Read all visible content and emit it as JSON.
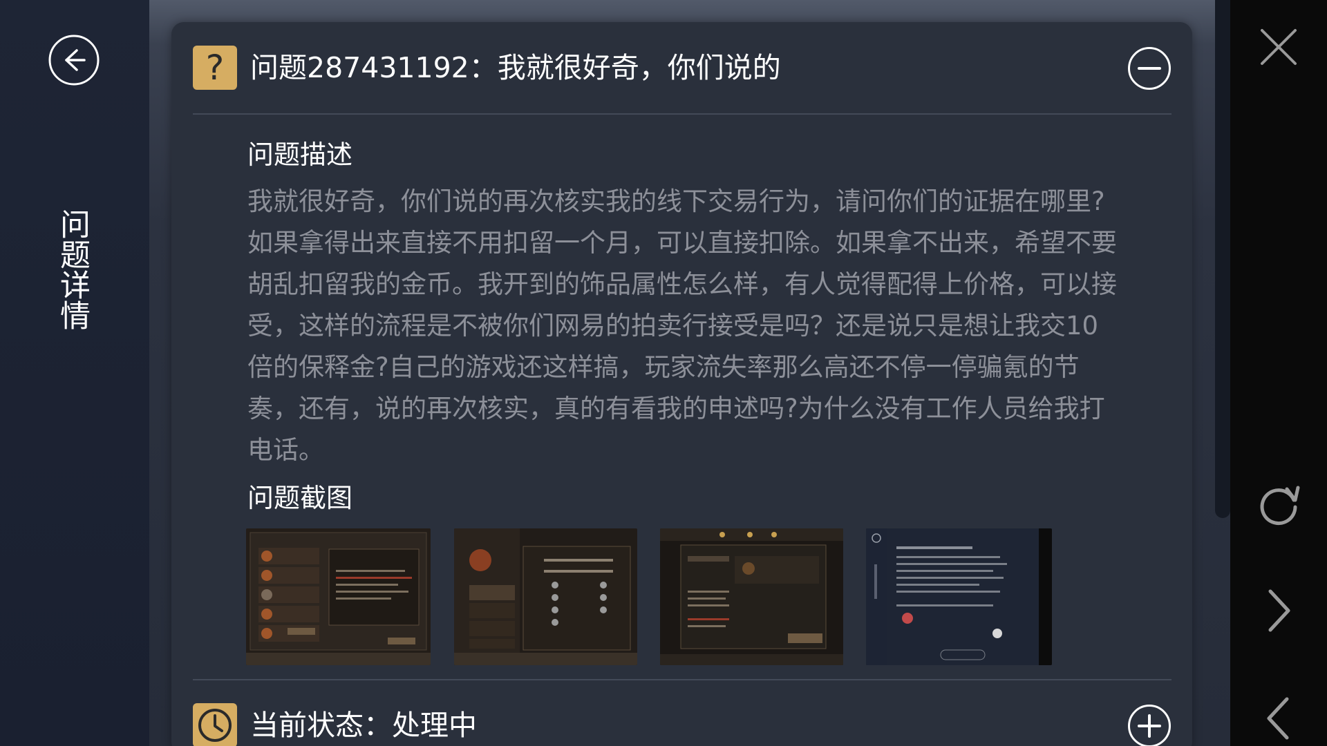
{
  "sidebar": {
    "title": "问题详情",
    "back_icon": "arrow-left-circle-icon"
  },
  "header": {
    "question_icon": "question-mark-icon",
    "title": "问题287431192：我就很好奇，你们说的",
    "collapse_icon": "minus-circle-icon"
  },
  "description": {
    "label": "问题描述",
    "text": "我就很好奇，你们说的再次核实我的线下交易行为，请问你们的证据在哪里?如果拿得出来直接不用扣留一个月，可以直接扣除。如果拿不出来，希望不要胡乱扣留我的金币。我开到的饰品属性怎么样，有人觉得配得上价格，可以接受，这样的流程是不被你们网易的拍卖行接受是吗？还是说只是想让我交10倍的保释金?自己的游戏还这样搞，玩家流失率那么高还不停一停骗氪的节奏，还有，说的再次核实，真的有看我的申述吗?为什么没有工作人员给我打电话。"
  },
  "screenshots": {
    "label": "问题截图",
    "items": [
      {
        "name": "screenshot-1"
      },
      {
        "name": "screenshot-2"
      },
      {
        "name": "screenshot-3"
      },
      {
        "name": "screenshot-4"
      }
    ]
  },
  "status": {
    "clock_icon": "clock-icon",
    "text": "当前状态：处理中",
    "expand_icon": "plus-circle-icon"
  },
  "rail": {
    "icons": [
      "close-icon",
      "refresh-icon",
      "chevron-right-icon",
      "chevron-left-icon"
    ]
  },
  "colors": {
    "accent": "#d6ad62",
    "card_bg": "#2a303c",
    "sidebar_bg": "#1e2535",
    "body_text": "#8d9099",
    "heading_text": "#ffffff"
  }
}
